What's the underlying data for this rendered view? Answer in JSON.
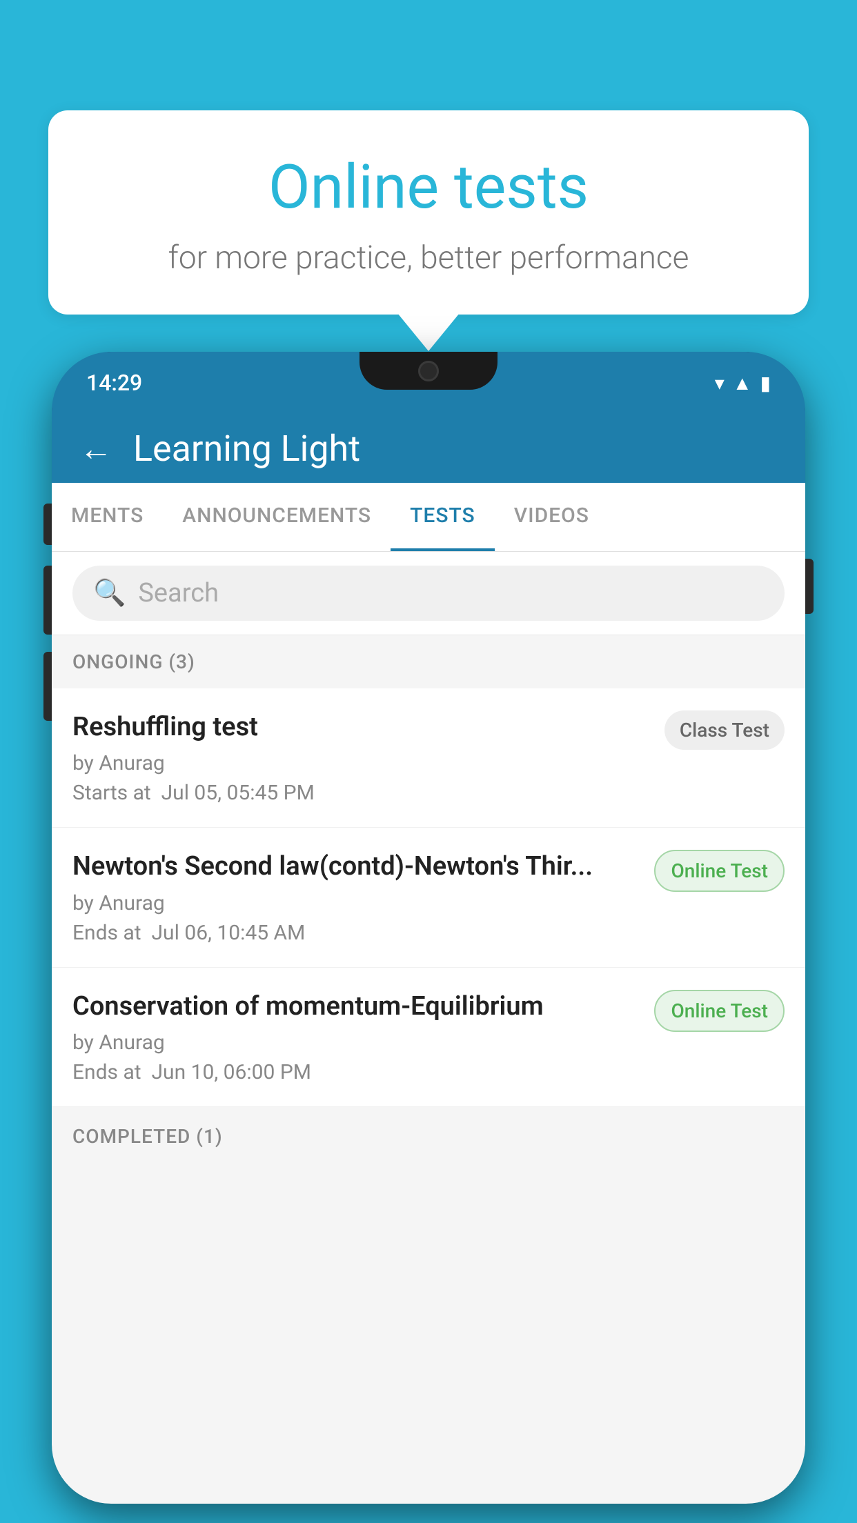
{
  "background_color": "#29b6d8",
  "speech_bubble": {
    "title": "Online tests",
    "subtitle": "for more practice, better performance"
  },
  "phone": {
    "status_bar": {
      "time": "14:29",
      "icons": [
        "wifi",
        "signal",
        "battery"
      ]
    },
    "app_header": {
      "title": "Learning Light",
      "back_label": "←"
    },
    "tabs": [
      {
        "label": "MENTS",
        "active": false
      },
      {
        "label": "ANNOUNCEMENTS",
        "active": false
      },
      {
        "label": "TESTS",
        "active": true
      },
      {
        "label": "VIDEOS",
        "active": false
      }
    ],
    "search": {
      "placeholder": "Search"
    },
    "sections": [
      {
        "title": "ONGOING (3)",
        "tests": [
          {
            "name": "Reshuffling test",
            "author": "by Anurag",
            "time_label": "Starts at",
            "time": "Jul 05, 05:45 PM",
            "badge": "Class Test",
            "badge_type": "class"
          },
          {
            "name": "Newton's Second law(contd)-Newton's Thir...",
            "author": "by Anurag",
            "time_label": "Ends at",
            "time": "Jul 06, 10:45 AM",
            "badge": "Online Test",
            "badge_type": "online"
          },
          {
            "name": "Conservation of momentum-Equilibrium",
            "author": "by Anurag",
            "time_label": "Ends at",
            "time": "Jun 10, 06:00 PM",
            "badge": "Online Test",
            "badge_type": "online"
          }
        ]
      }
    ],
    "completed_section_title": "COMPLETED (1)"
  }
}
